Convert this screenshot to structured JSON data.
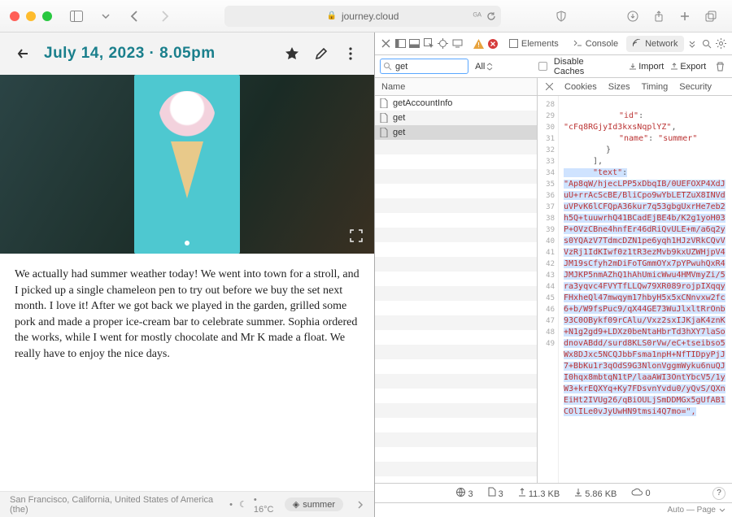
{
  "browser": {
    "url_host": "journey.cloud",
    "lock": "🔒"
  },
  "journey": {
    "title": "July 14, 2023 · 8.05pm",
    "body": "We actually had summer weather today! We went into town for a stroll, and I picked up a single chameleon pen to try out before we buy the set next month. I love it! After we got back we played in the garden, grilled some pork and made a proper ice-cream bar to celebrate summer. Sophia ordered the works, while I went for mostly chocolate and Mr K made a float. We really have to enjoy the nice days.",
    "footer": {
      "location": "San Francisco, California, United States of America (the)",
      "sep": "•",
      "weather_icon": "☾",
      "temp": "• 16°C",
      "tag_label": "summer",
      "tag_icon": "⌂"
    }
  },
  "devtools": {
    "tabs": {
      "elements": "Elements",
      "console": "Console",
      "network": "Network"
    },
    "filter_value": "get",
    "all_label": "All",
    "disable_caches": "Disable Caches",
    "import": "Import",
    "export": "Export",
    "col1_header": "Name",
    "requests": [
      {
        "name": "getAccountInfo"
      },
      {
        "name": "get"
      },
      {
        "name": "get"
      }
    ],
    "resp_tabs": {
      "cookies": "Cookies",
      "sizes": "Sizes",
      "timing": "Timing",
      "security": "Security"
    },
    "gutter_lines": [
      "28",
      "29",
      "30",
      "31",
      "32",
      "",
      "",
      "",
      "",
      "",
      "",
      "",
      "",
      "",
      "",
      "",
      "",
      "",
      "",
      "",
      "",
      "33",
      "34",
      "",
      "35",
      "36",
      "37",
      "38",
      "39",
      "40",
      "41",
      "42",
      "43",
      "44",
      "45",
      "46",
      "47",
      "48",
      "49"
    ],
    "json_preview": {
      "id_key": "\"id\"",
      "id_val": "\"cFq8RGjyId3kxsNqplYZ\"",
      "name_key": "\"name\"",
      "name_val": "\"summer\"",
      "brace1": "}",
      "bracket": "],",
      "text_key": "\"text\"",
      "blob": "\"Ap8qW/hjecLPP5xDbqIB/0UEFOXP4XdJuU+rrAcScBE/BliCpo9wYbLETZuX8INVduVPvK6lCFQpA36kur7q53gbgUxrHe7eb2h5Q+tuuwrhQ41BCadEjBE4b/K2g1yoH03P+OVzCBne4hnfEr46dRiQvULE+m/a6q2ys0YQAzV7TdmcDZN1pe6yqh1HJzVRkCQvVVzRj1IdKIwf0z1tR3ezMvb9kxUZWHjpV4JM19sCfyh2mDiFoTGmmOYx7pYPwuhQxR4JMJKP5nmAZhQ1hAhUmicWwu4HMVmyZi/5ra3yqvc4FVYTfLLQw79XR089rojpIXqqyFHxheQl47mwqym17hbyH5x5xCNnvxw2fc6+b/W9fsPuc9/qX44GE73WuJlxltRrOnb93C0OBykf09rCAlu/Vxz2sxIJKjaK4znK+N1g2gd9+LDXz0beNtaHbrTd3hXY7laSodnovABdd/surd8KLS0rVw/eC+tseibso5Wx8DJxc5NCQJbbFsma1npH+NfTIDpyPjJ7+BbKu1r3qOdS9G3NlonVggmWyku6nuQJI0hqx8mbtqN1tP/laaAWI3OntYbcV5/1yW3+krEQXYq+Ky7FDsvnYvdu0/yQvS/QXnEiHt2IVUg26/qBiOULjSmDDMGx5gUfAB1COlILe0vJyUwHN9tmsi4Q7mo=\","
    },
    "status": {
      "globe": "3",
      "docs": "3",
      "up": "11.3 KB",
      "down": "5.86 KB",
      "cloud": "0"
    },
    "footer_text": "Auto — Page"
  }
}
